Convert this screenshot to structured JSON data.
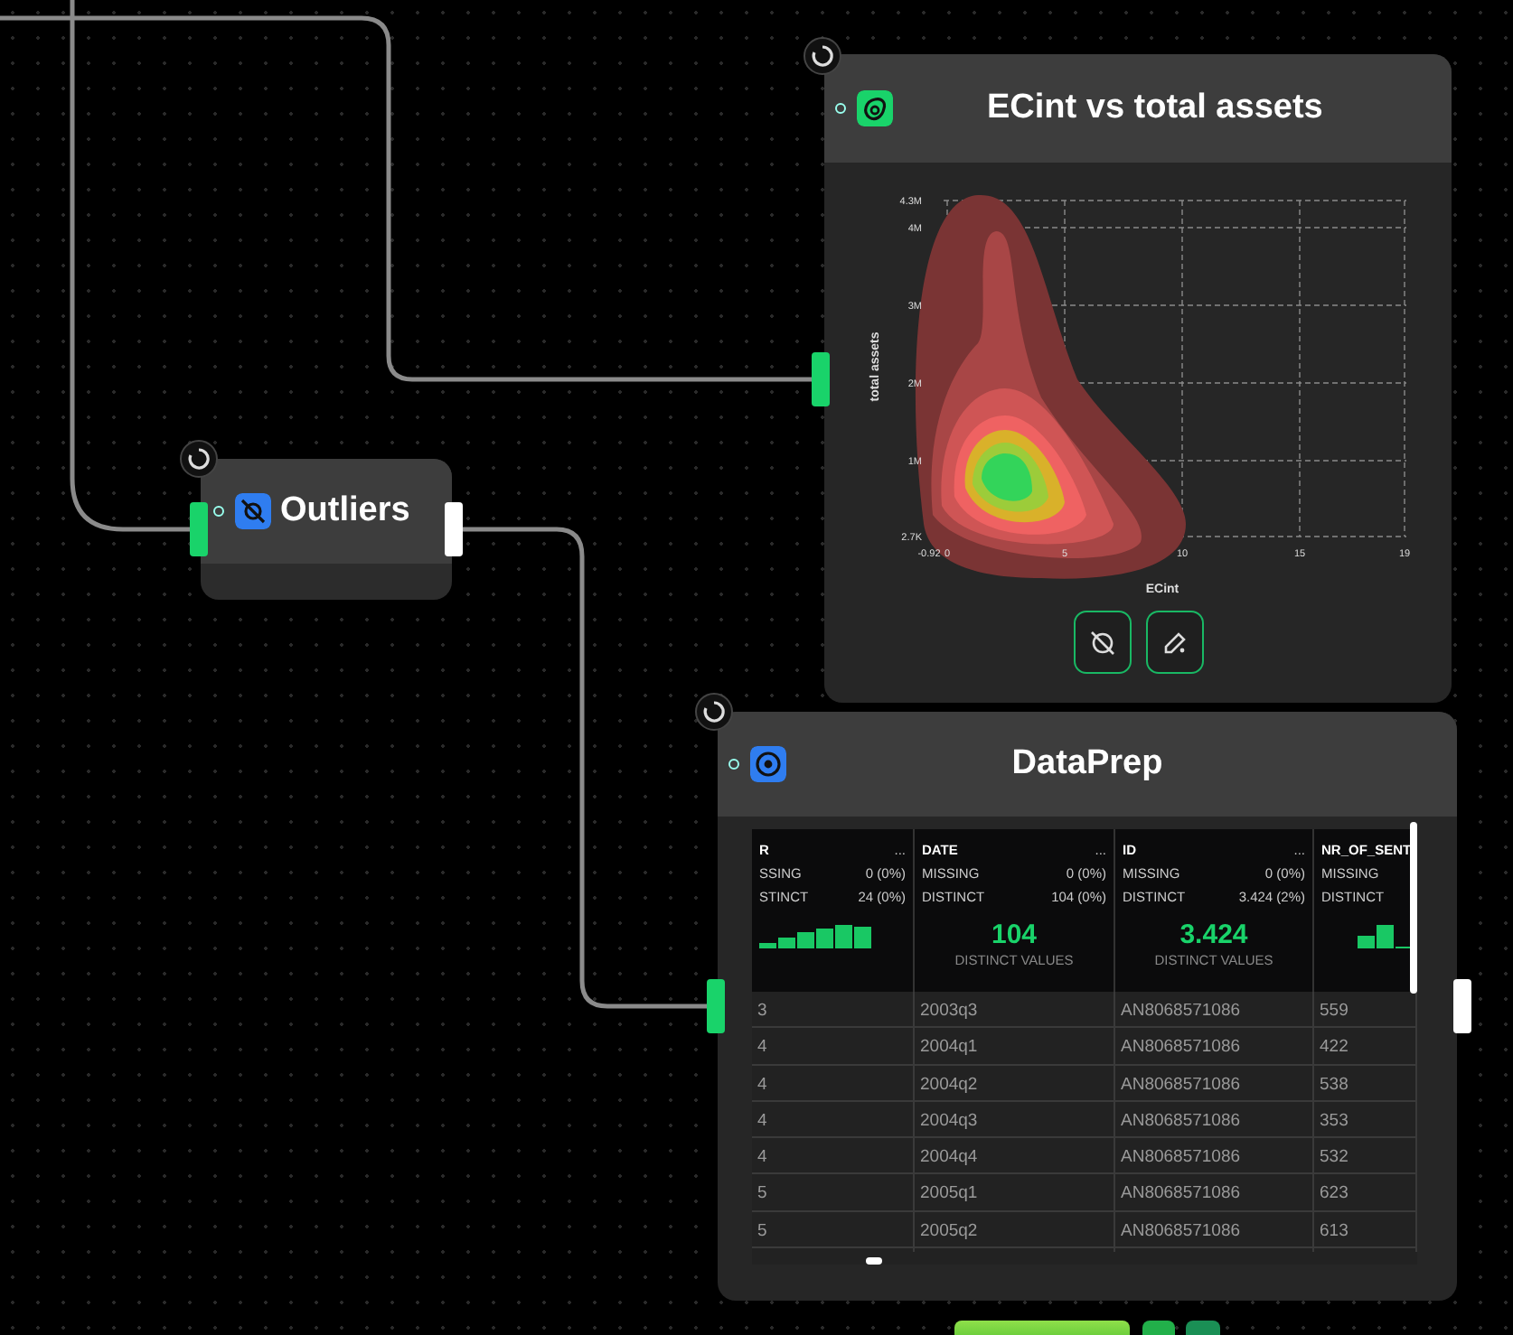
{
  "nodes": [
    {
      "kind": "chart",
      "title": "ECint vs total assets",
      "chart": {
        "xlabel": "ECint",
        "ylabel": "total assets",
        "xticks": [
          "-0.92",
          "0",
          "5",
          "10",
          "15",
          "19"
        ],
        "yticks": [
          "4.3M",
          "4M",
          "3M",
          "2M",
          "1M",
          "2.7K"
        ]
      }
    },
    {
      "kind": "filter",
      "title": "Outliers"
    },
    {
      "kind": "table",
      "title": "DataPrep",
      "table": {
        "columns": [
          {
            "name": "R",
            "menu": "...",
            "missing_label": "SSING",
            "missing": "0 (0%)",
            "distinct_label": "STINCT",
            "distinct": "24 (0%)",
            "kind": "histogram"
          },
          {
            "name": "DATE",
            "menu": "...",
            "missing_label": "MISSING",
            "missing": "0 (0%)",
            "distinct_label": "DISTINCT",
            "distinct": "104 (0%)",
            "kind": "count",
            "count": "104",
            "count_label": "DISTINCT VALUES"
          },
          {
            "name": "ID",
            "menu": "...",
            "missing_label": "MISSING",
            "missing": "0 (0%)",
            "distinct_label": "DISTINCT",
            "distinct": "3.424 (2%)",
            "kind": "count",
            "count": "3.424",
            "count_label": "DISTINCT VALUES"
          },
          {
            "name": "NR_OF_SENT",
            "missing_label": "MISSING",
            "distinct_label": "DISTINCT",
            "kind": "histogram"
          }
        ],
        "rows": [
          [
            "3",
            "2003q3",
            "AN8068571086",
            "559"
          ],
          [
            "4",
            "2004q1",
            "AN8068571086",
            "422"
          ],
          [
            "4",
            "2004q2",
            "AN8068571086",
            "538"
          ],
          [
            "4",
            "2004q3",
            "AN8068571086",
            "353"
          ],
          [
            "4",
            "2004q4",
            "AN8068571086",
            "532"
          ],
          [
            "5",
            "2005q1",
            "AN8068571086",
            "623"
          ],
          [
            "5",
            "2005q2",
            "AN8068571086",
            "613"
          ]
        ]
      }
    }
  ]
}
